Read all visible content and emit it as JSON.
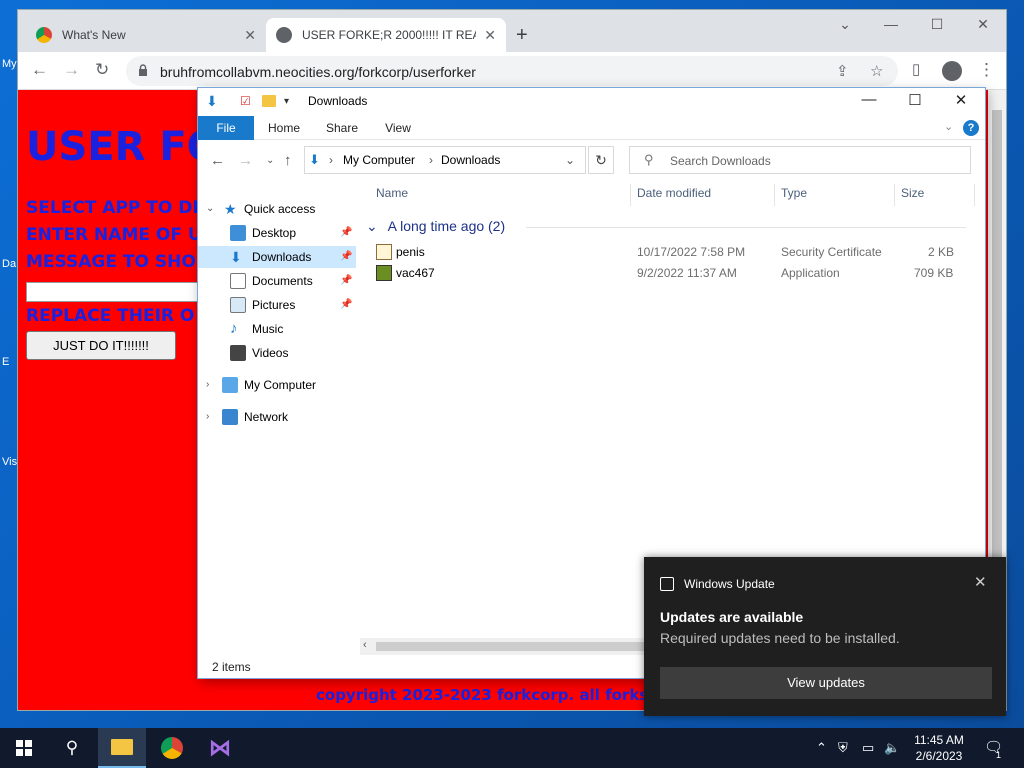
{
  "desktop": {
    "icon_labels": [
      "My",
      "Da",
      "E",
      "Vis"
    ]
  },
  "chrome": {
    "tabs": [
      {
        "title": "What's New",
        "close": "✕"
      },
      {
        "title": "USER FORKE;R 2000!!!!! IT REALL",
        "close": "✕"
      }
    ],
    "new_tab": "+",
    "url": "bruhfromcollabvm.neocities.org/forkcorp/userforker"
  },
  "page": {
    "title": "USER FO",
    "line1": "SELECT APP TO DE",
    "line2": "ENTER NAME OF U",
    "line3": "MESSAGE TO SHO",
    "line4": "REPLACE THEIR O",
    "button": "JUST DO IT!!!!!!!",
    "copyright": "copyright 2023-2023 forkcorp. all forks res"
  },
  "explorer": {
    "title": "Downloads",
    "ribbon_tabs": [
      "File",
      "Home",
      "Share",
      "View"
    ],
    "address": {
      "root": "My Computer",
      "current": "Downloads"
    },
    "search_placeholder": "Search Downloads",
    "nav": {
      "quick_access": "Quick access",
      "items": [
        "Desktop",
        "Downloads",
        "Documents",
        "Pictures",
        "Music",
        "Videos"
      ],
      "my_computer": "My Computer",
      "network": "Network"
    },
    "columns": [
      "Name",
      "Date modified",
      "Type",
      "Size"
    ],
    "group": "A long time ago (2)",
    "files": [
      {
        "name": "penis",
        "date": "10/17/2022 7:58 PM",
        "type": "Security Certificate",
        "size": "2 KB"
      },
      {
        "name": "vac467",
        "date": "9/2/2022 11:37 AM",
        "type": "Application",
        "size": "709 KB"
      }
    ],
    "status": "2 items"
  },
  "toast": {
    "app": "Windows Update",
    "heading": "Updates are available",
    "body": "Required updates need to be installed.",
    "button": "View updates"
  },
  "taskbar": {
    "time": "11:45 AM",
    "date": "2/6/2023",
    "notif_count": "1"
  },
  "colors": {
    "page_red": "#ff0000",
    "page_text_blue": "#1a22e0",
    "explorer_accent": "#1979ca",
    "taskbar": "#101a2c"
  }
}
